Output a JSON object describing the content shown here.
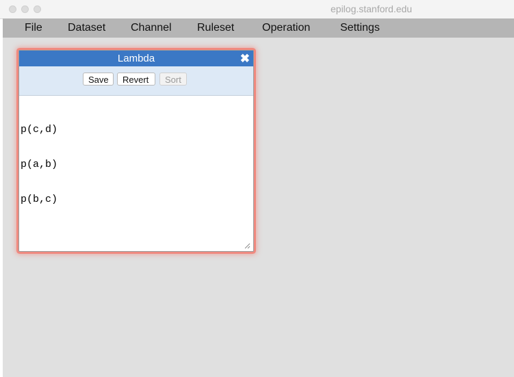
{
  "titlebar": {
    "url": "epilog.stanford.edu"
  },
  "menubar": {
    "items": [
      "File",
      "Dataset",
      "Channel",
      "Ruleset",
      "Operation",
      "Settings"
    ]
  },
  "dialog": {
    "title": "Lambda",
    "close_glyph": "✖",
    "buttons": {
      "save": "Save",
      "revert": "Revert",
      "sort": "Sort",
      "sort_enabled": false
    },
    "editor_lines": [
      "p(c,d)",
      "p(a,b)",
      "p(b,c)"
    ]
  },
  "colors": {
    "accent": "#3b78c5",
    "dialog_glow": "#f08a80",
    "toolbar_bg": "#dde9f6",
    "menubar_bg": "#b5b5b5"
  },
  "icons": [
    "close-icon",
    "resize-handle-icon"
  ]
}
